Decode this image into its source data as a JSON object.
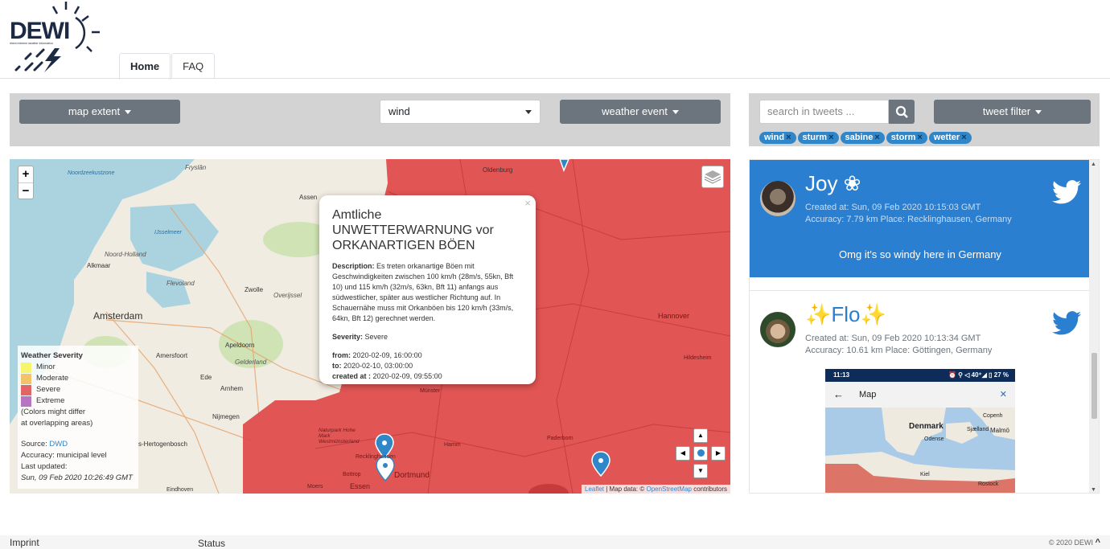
{
  "logo": {
    "text": "DEWI",
    "subtitle": "direct extreme weather information"
  },
  "nav": {
    "tabs": [
      {
        "label": "Home"
      },
      {
        "label": "FAQ"
      }
    ]
  },
  "map_controls": {
    "map_extent_label": "map extent",
    "event_select_value": "wind",
    "weather_event_label": "weather event"
  },
  "tweet_controls": {
    "search_placeholder": "search in tweets ...",
    "tweet_filter_label": "tweet filter",
    "tags": [
      "wind",
      "sturm",
      "sabine",
      "storm",
      "wetter"
    ]
  },
  "map": {
    "zoom_in": "+",
    "zoom_out": "−",
    "places": [
      "Noordzeekustzone",
      "Fryslân",
      "Oldenburg",
      "Assen",
      "Noord-Holland",
      "IJsselmeer",
      "Alkmaar",
      "Flevoland",
      "Zwolle",
      "Overijssel",
      "Amsterdam",
      "Apeldoorn",
      "Amersfoort",
      "Gelderland",
      "Ede",
      "Arnhem",
      "Nijmegen",
      "s-Hertogenbosch",
      "Hannover",
      "Hildesheim",
      "Paderborn",
      "Hamm",
      "Dortmund",
      "Essen",
      "Bottrop",
      "Recklinghausen",
      "Naturpark Hohe Mark Westmünsterland",
      "Münster",
      "Eindhoven",
      "Moers"
    ],
    "popup": {
      "title": "Amtliche UNWETTERWARNUNG vor ORKANARTIGEN BÖEN",
      "description_label": "Description:",
      "description": "Es treten orkanartige Böen mit Geschwindigkeiten zwischen 100 km/h (28m/s, 55kn, Bft 10) und 115 km/h (32m/s, 63kn, Bft 11) anfangs aus südwestlicher, später aus westlicher Richtung auf. In Schauernähe muss mit Orkanböen bis 120 km/h (33m/s, 64kn, Bft 12) gerechnet werden.",
      "severity_label": "Severity:",
      "severity": "Severe",
      "from_label": "from:",
      "from": "2020-02-09, 16:00:00",
      "to_label": "to:",
      "to": "2020-02-10, 03:00:00",
      "created_label": "created at :",
      "created": "2020-02-09, 09:55:00",
      "close": "×"
    },
    "legend": {
      "title": "Weather Severity",
      "levels": [
        {
          "label": "Minor",
          "color": "#f5f56e"
        },
        {
          "label": "Moderate",
          "color": "#f3c36a"
        },
        {
          "label": "Severe",
          "color": "#e16565"
        },
        {
          "label": "Extreme",
          "color": "#b774c2"
        }
      ],
      "note1": "(Colors might differ",
      "note2": "at overlapping areas)",
      "source_label": "Source:",
      "source": "DWD",
      "accuracy": "Accuracy: municipal level",
      "updated_label": "Last updated:",
      "updated": "Sun, 09 Feb 2020 10:26:49 GMT"
    },
    "attribution": {
      "leaflet": "Leaflet",
      "mid": " | Map data: © ",
      "osm": "OpenStreetMap",
      "end": " contributors"
    },
    "colors": {
      "severe": "#e04848",
      "water": "#aad3df",
      "land": "#f0ece1"
    }
  },
  "tweets": [
    {
      "name": "Joy ❀",
      "created": "Created at: Sun, 09 Feb 2020 10:15:03 GMT",
      "accuracy": "Accuracy: 7.79 km Place: Recklinghausen, Germany",
      "text": "Omg it's so windy here in Germany",
      "bg": "#2b7fd0"
    },
    {
      "name": "Flo",
      "created": "Created at: Sun, 09 Feb 2020 10:13:34 GMT",
      "accuracy": "Accuracy: 10.61 km Place: Göttingen, Germany",
      "sparkle": "✨",
      "image": {
        "time": "11:13",
        "status_icons": "⏰ ⚲ ◁ 40⁺◢ ▯ 27 %",
        "back": "←",
        "title": "Map",
        "close": "✕",
        "labels": [
          "Denmark",
          "Odense",
          "Sjælland",
          "Malmö",
          "Copenh",
          "Kiel",
          "Rostock"
        ]
      }
    }
  ],
  "footer": {
    "imprint": "Imprint",
    "status": "Status",
    "copyright": "© 2020 DEWI",
    "chevron": "^"
  }
}
